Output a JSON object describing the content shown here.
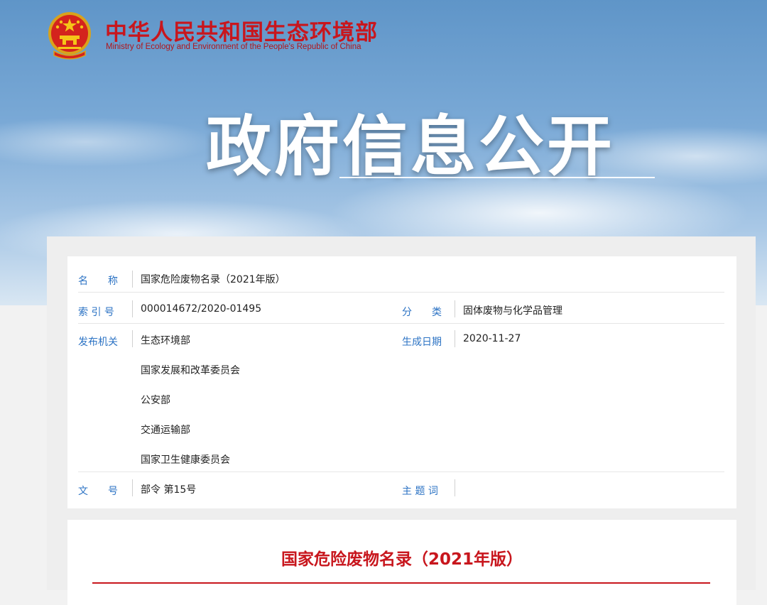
{
  "header": {
    "org_name_cn": "中华人民共和国生态环境部",
    "org_name_en": "Ministry of Ecology and Environment of the People's Republic of China",
    "emblem_icon": "national-emblem-icon",
    "banner_title": "政府信息公开"
  },
  "meta": {
    "name_label": "名　　称",
    "name_value": "国家危险废物名录（2021年版）",
    "index_label": "索 引 号",
    "index_value": "000014672/2020-01495",
    "category_label": "分　　类",
    "category_value": "固体废物与化学品管理",
    "issuer_label": "发布机关",
    "issuers": [
      "生态环境部",
      "国家发展和改革委员会",
      "公安部",
      "交通运输部",
      "国家卫生健康委员会"
    ],
    "date_label": "生成日期",
    "date_value": "2020-11-27",
    "doc_no_label": "文　　号",
    "doc_no_value": "部令 第15号",
    "keywords_label": "主 题 词",
    "keywords_value": ""
  },
  "document": {
    "title": "国家危险废物名录（2021年版）"
  },
  "colors": {
    "brand_red": "#c8161d",
    "label_blue": "#2c73c4"
  }
}
